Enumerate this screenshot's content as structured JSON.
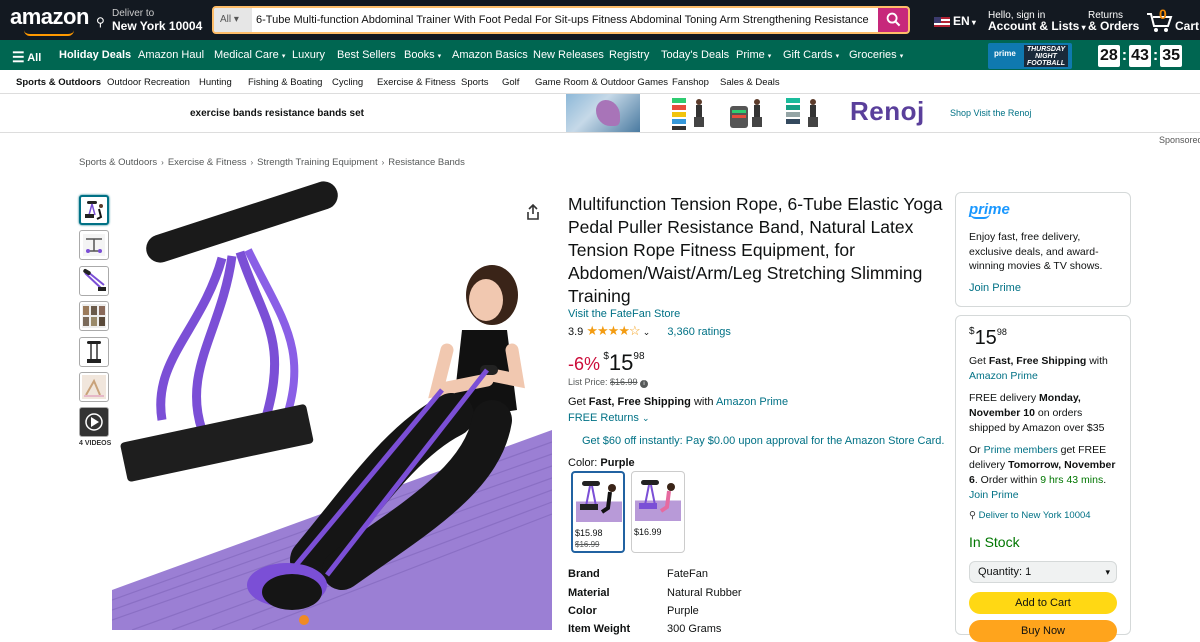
{
  "header": {
    "logo": "amazon",
    "deliver_to": "Deliver to",
    "location": "New York 10004",
    "search_category": "All",
    "search_value": "6-Tube Multi-function Abdominal Trainer With Foot Pedal For Sit-ups Fitness Abdominal Toning Arm Strengthening Resistance",
    "language": "EN",
    "account_line1": "Hello, sign in",
    "account_line2": "Account & Lists",
    "returns_line1": "Returns",
    "returns_line2": "& Orders",
    "cart_count": "0",
    "cart_label": "Cart"
  },
  "nav": {
    "all": "All",
    "items": [
      "Holiday Deals",
      "Amazon Haul",
      "Medical Care",
      "Luxury",
      "Best Sellers",
      "Books",
      "Amazon Basics",
      "New Releases",
      "Registry",
      "Today's Deals",
      "Prime",
      "Gift Cards",
      "Groceries"
    ],
    "prime_badge": "prime",
    "tnf_line1": "THURSDAY",
    "tnf_line2": "NIGHT",
    "tnf_line3": "FOOTBALL",
    "countdown": [
      "28",
      "43",
      "35"
    ]
  },
  "subnav": [
    "Sports & Outdoors",
    "Outdoor Recreation",
    "Hunting",
    "Fishing & Boating",
    "Cycling",
    "Exercise & Fitness",
    "Sports",
    "Golf",
    "Game Room & Outdoor Games",
    "Fanshop",
    "Sales & Deals"
  ],
  "ad": {
    "text": "exercise bands resistance bands set",
    "brand": "Renoj",
    "shop_link": "Shop Visit the Renoj",
    "sponsored": "Sponsored"
  },
  "breadcrumb": [
    "Sports & Outdoors",
    "Exercise & Fitness",
    "Strength Training Equipment",
    "Resistance Bands"
  ],
  "gallery": {
    "videos_label": "4 VIDEOS"
  },
  "product": {
    "title": "Multifunction Tension Rope, 6-Tube Elastic Yoga Pedal Puller Resistance Band, Natural Latex Tension Rope Fitness Equipment, for Abdomen/Waist/Arm/Leg Stretching Slimming Training",
    "store": "Visit the FateFan Store",
    "rating": "3.9",
    "stars": "★★★★☆",
    "ratings_count": "3,360 ratings",
    "discount": "-6%",
    "price_symbol": "$",
    "price_whole": "15",
    "price_fraction": "98",
    "list_price_label": "List Price:",
    "list_price": "$16.99",
    "ship_prefix": "Get",
    "ship_bold": "Fast, Free Shipping",
    "ship_with": "with",
    "ship_link": "Amazon Prime",
    "free_returns": "FREE Returns",
    "card_offer": "Get $60 off instantly: Pay $0.00 upon approval for the Amazon Store Card.",
    "color_label": "Color:",
    "color_value": "Purple",
    "swatches": [
      {
        "price": "$15.98",
        "old": "$16.99"
      },
      {
        "price": "$16.99",
        "old": ""
      }
    ],
    "specs": [
      {
        "k": "Brand",
        "v": "FateFan"
      },
      {
        "k": "Material",
        "v": "Natural Rubber"
      },
      {
        "k": "Color",
        "v": "Purple"
      },
      {
        "k": "Item Weight",
        "v": "300 Grams"
      }
    ]
  },
  "prime_box": {
    "logo": "prime",
    "text": "Enjoy fast, free delivery, exclusive deals, and award-winning movies & TV shows.",
    "join": "Join Prime"
  },
  "buy_box": {
    "price_symbol": "$",
    "price_whole": "15",
    "price_fraction": "98",
    "ship_prefix": "Get",
    "ship_bold": "Fast, Free Shipping",
    "ship_with": "with",
    "ship_link": "Amazon Prime",
    "free_delivery_prefix": "FREE delivery",
    "free_delivery_date": "Monday, November 10",
    "free_delivery_suffix": "on orders shipped by Amazon over $35",
    "or": "Or",
    "prime_members": "Prime members",
    "get_free": "get FREE delivery",
    "fast_date": "Tomorrow, November 6",
    "order_within": ". Order within",
    "time_left": "9 hrs 43 mins",
    "period": ".",
    "join": "Join Prime",
    "deliver_to": "Deliver to New York 10004",
    "stock": "In Stock",
    "quantity": "Quantity: 1",
    "add_to_cart": "Add to Cart",
    "buy_now": "Buy Now"
  },
  "colors": {
    "nav_dark": "#131921",
    "nav_green": "#006651",
    "price_red": "#cc0c39",
    "link": "#007185",
    "stock_green": "#007600",
    "cart_yellow": "#ffd814",
    "buy_orange": "#ffa41c",
    "product_purple": "#7b4fd6"
  }
}
